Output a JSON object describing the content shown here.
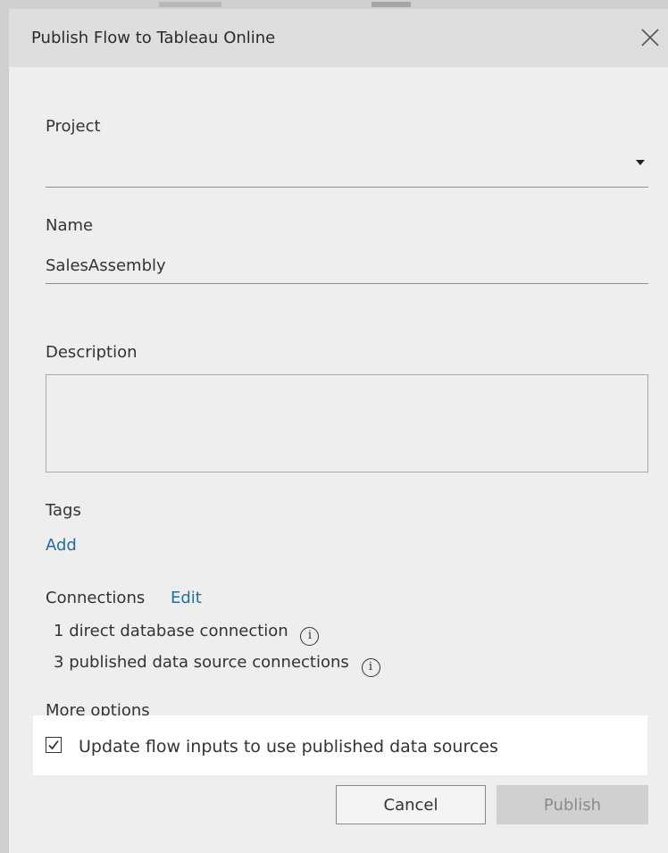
{
  "dialog": {
    "title": "Publish Flow to Tableau Online"
  },
  "project": {
    "label": "Project",
    "selected_value": ""
  },
  "name": {
    "label": "Name",
    "value": "SalesAssembly"
  },
  "description": {
    "label": "Description",
    "value": ""
  },
  "tags": {
    "label": "Tags",
    "add_label": "Add"
  },
  "connections": {
    "label": "Connections",
    "edit_label": "Edit",
    "items": [
      {
        "count": "1",
        "text": "direct database connection"
      },
      {
        "count": "3",
        "text": "published data source connections"
      }
    ],
    "info_glyph": "i"
  },
  "more_options": {
    "label": "More options",
    "checkbox_label": "Update flow inputs to use published data sources",
    "checked": true
  },
  "buttons": {
    "cancel": "Cancel",
    "publish": "Publish",
    "publish_enabled": false
  },
  "icons": [
    "close-icon",
    "dropdown-caret-icon",
    "info-icon",
    "checkmark-icon"
  ],
  "colors": {
    "link": "#1f6e9a",
    "header_bg": "#dedede",
    "dialog_bg": "#eeeeee",
    "highlight_bg": "#ffffff",
    "publish_disabled_bg": "#d0d0d0"
  }
}
